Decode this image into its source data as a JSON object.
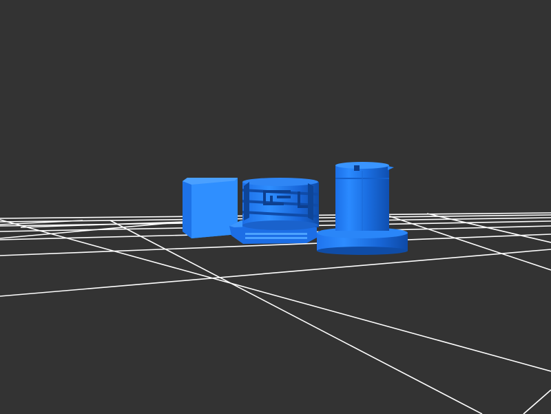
{
  "viewer": {
    "background_color": "#333333",
    "grid_color": "#ffffff",
    "model_color": "#1a75ff"
  },
  "objects": [
    {
      "name": "square-box-part",
      "shape": "box"
    },
    {
      "name": "threaded-cap-part",
      "shape": "threaded-cylinder"
    },
    {
      "name": "flanged-pin-part",
      "shape": "cylinder-on-flange"
    }
  ]
}
